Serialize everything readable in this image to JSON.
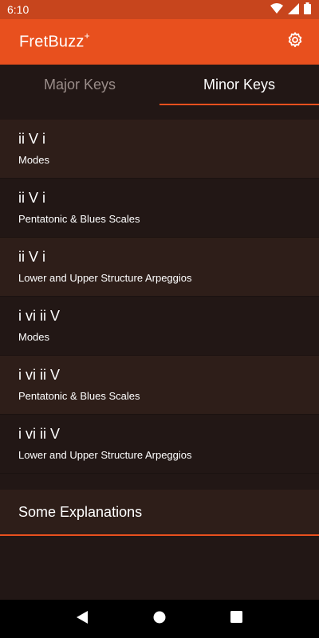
{
  "status_bar": {
    "time": "6:10",
    "icons": [
      "wifi-icon",
      "signal-icon",
      "battery-icon"
    ]
  },
  "app_bar": {
    "title": "FretBuzz",
    "title_superscript": "+",
    "settings_icon": "gear-icon",
    "color": "#e8501e"
  },
  "tabs": [
    {
      "label": "Major Keys",
      "selected": false
    },
    {
      "label": "Minor Keys",
      "selected": true
    }
  ],
  "items": [
    {
      "title": "ii V i",
      "subtitle": "Modes"
    },
    {
      "title": "ii V i",
      "subtitle": "Pentatonic & Blues Scales"
    },
    {
      "title": "ii V i",
      "subtitle": "Lower and Upper Structure Arpeggios"
    },
    {
      "title": "i vi ii V",
      "subtitle": "Modes"
    },
    {
      "title": "i vi ii V",
      "subtitle": "Pentatonic & Blues Scales"
    },
    {
      "title": "i vi ii V",
      "subtitle": "Lower and Upper Structure Arpeggios"
    }
  ],
  "explanations": {
    "label": "Some Explanations"
  },
  "nav_bar": {
    "icons": [
      "back-icon",
      "home-icon",
      "recents-icon"
    ]
  }
}
